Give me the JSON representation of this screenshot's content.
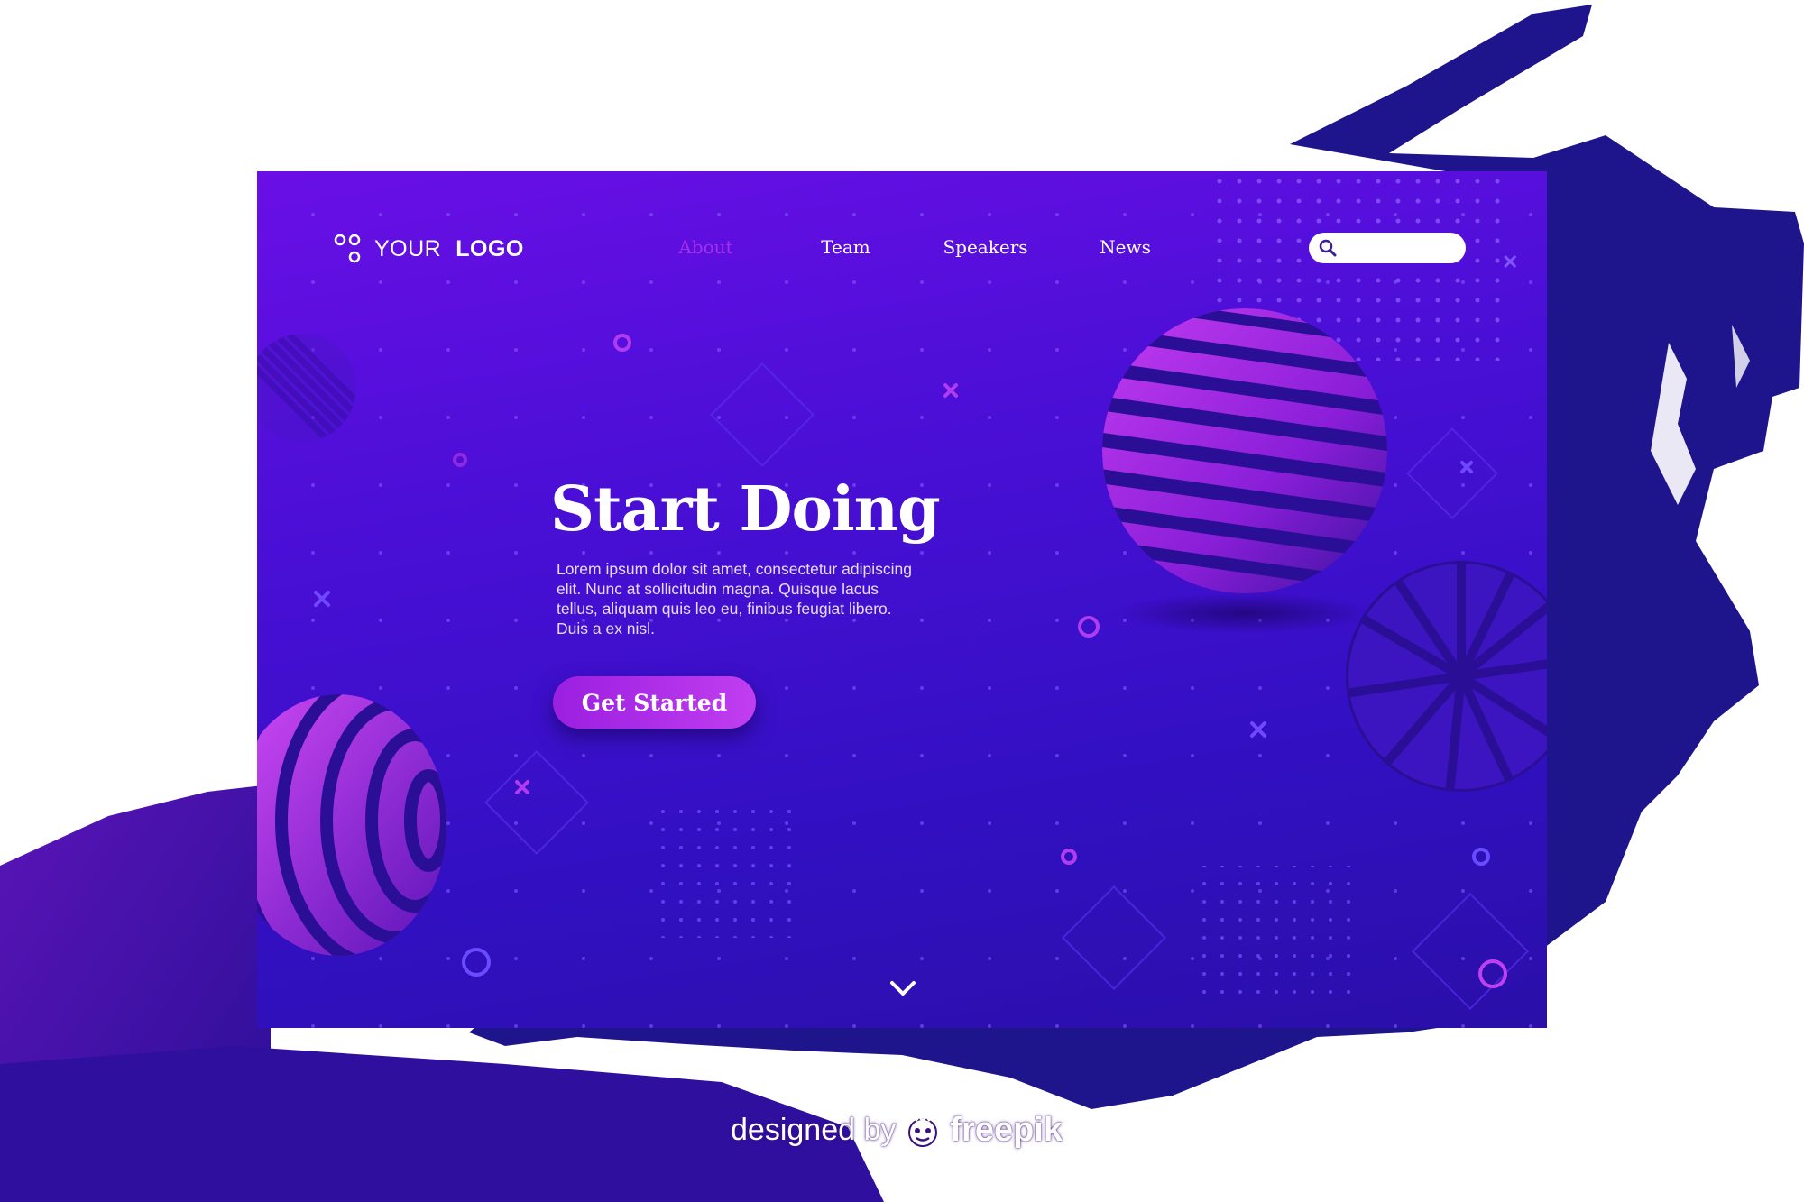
{
  "logo": {
    "text_regular": "YOUR",
    "text_bold": "LOGO",
    "icon": "logo-circles-icon"
  },
  "nav": {
    "items": [
      {
        "label": "About",
        "active": true
      },
      {
        "label": "Team",
        "active": false
      },
      {
        "label": "Speakers",
        "active": false
      },
      {
        "label": "News",
        "active": false
      }
    ]
  },
  "search": {
    "icon": "search-icon",
    "value": "",
    "placeholder": ""
  },
  "hero": {
    "title": "Start Doing",
    "body": "Lorem ipsum dolor sit amet, consectetur adipiscing elit. Nunc at sollicitudin magna. Quisque lacus tellus, aliquam quis leo eu, finibus feugiat libero. Duis a ex nisl.",
    "cta_label": "Get Started"
  },
  "scroll_indicator": {
    "icon": "chevron-down-icon"
  },
  "credit": {
    "prefix": "designed by",
    "brand": "freepik",
    "icon": "freepik-mascot-icon"
  },
  "colors": {
    "bg_top": "#6a0fe6",
    "bg_bottom": "#2a0fa8",
    "accent_magenta": "#c13ef0",
    "nav_active": "#a62fe8",
    "brush_navy": "#1e148c"
  }
}
